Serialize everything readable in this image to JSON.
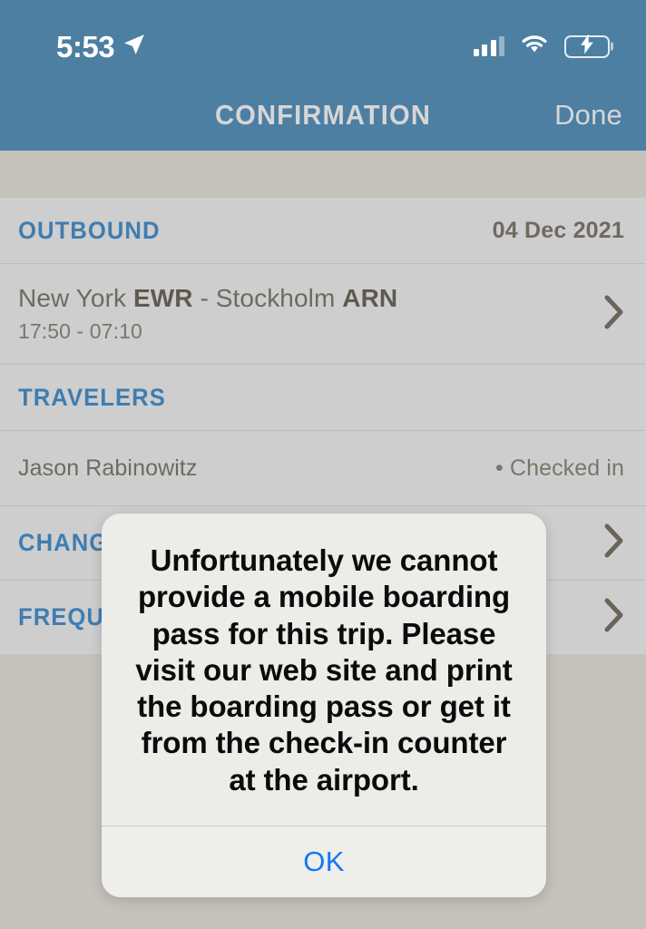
{
  "statusbar": {
    "time": "5:53",
    "location_icon": "location-arrow-icon",
    "signal_icon": "cellular-signal-icon",
    "wifi_icon": "wifi-icon",
    "battery_icon": "battery-charging-icon",
    "battery_color": "#4cd760"
  },
  "navbar": {
    "title": "CONFIRMATION",
    "done_label": "Done",
    "background": "#4d7fa3",
    "text_color": "#d6d6d4"
  },
  "sections": {
    "outbound": {
      "title": "OUTBOUND",
      "date": "04 Dec 2021",
      "flight": {
        "origin_city": "New York ",
        "origin_code": "EWR",
        "separator": " - ",
        "destination_city": "Stockholm ",
        "destination_code": "ARN",
        "times": "17:50 - 07:10",
        "chevron_icon": "chevron-right-icon"
      }
    },
    "travelers": {
      "title": "TRAVELERS",
      "list": [
        {
          "name": "Jason Rabinowitz",
          "status": "• Checked in"
        }
      ]
    },
    "links": [
      {
        "title": "CHANGE FLIGHT",
        "chevron_icon": "chevron-right-icon"
      },
      {
        "title": "FREQUENT FLYER",
        "chevron_icon": "chevron-right-icon"
      }
    ]
  },
  "alert": {
    "message": "Unfortunately we cannot provide a mobile boarding pass for this trip. Please visit our web site and print the boarding pass or get it from the check-in counter at the airport.",
    "ok_label": "OK",
    "ok_color": "#1277f2"
  },
  "colors": {
    "accent_blue": "#3f7db0",
    "nav_blue": "#4d7fa3",
    "list_bg": "#cecece",
    "page_bg": "#c5c2bc",
    "text_brown": "#6f6a5f"
  }
}
